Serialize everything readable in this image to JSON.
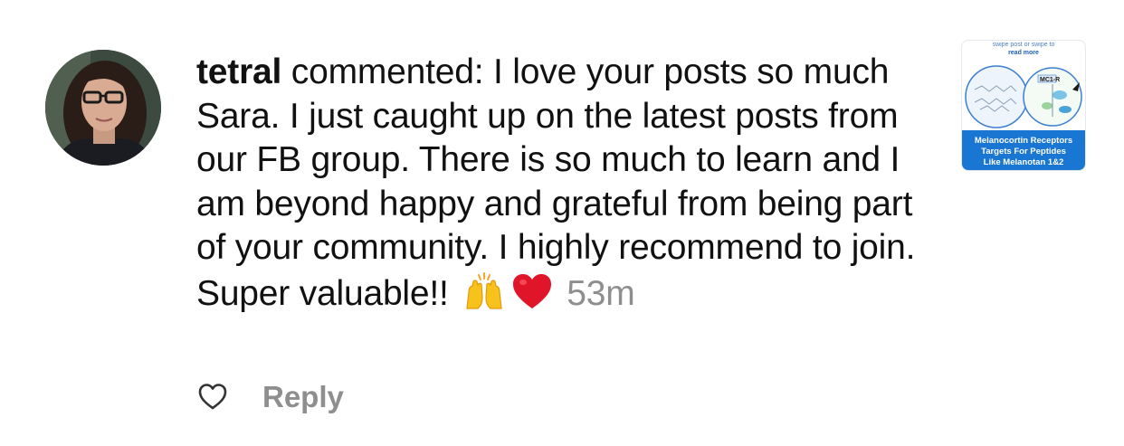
{
  "comment": {
    "username": "tetral",
    "text": " commented: I love your posts so much Sara. I just caught up on the latest posts from our FB group. There is so much to learn and I am beyond happy and grateful from being part of your community. I highly recommend to join. Super valuable!!",
    "time": "53m"
  },
  "actions": {
    "reply_label": "Reply"
  },
  "thumbnail": {
    "top_line1": "swipe post or swipe to",
    "top_line2": "read more",
    "diagram_label": "MC1-R",
    "banner_line1": "Melanocortin Receptors",
    "banner_line2": "Targets For Peptides",
    "banner_line3": "Like Melanotan 1&2"
  },
  "icons": {
    "emoji_1": "raising-hands-icon",
    "emoji_2": "red-heart-icon",
    "like": "heart-outline-icon"
  },
  "colors": {
    "text": "#111111",
    "muted": "#8e8e8e",
    "accent": "#1976d2"
  }
}
